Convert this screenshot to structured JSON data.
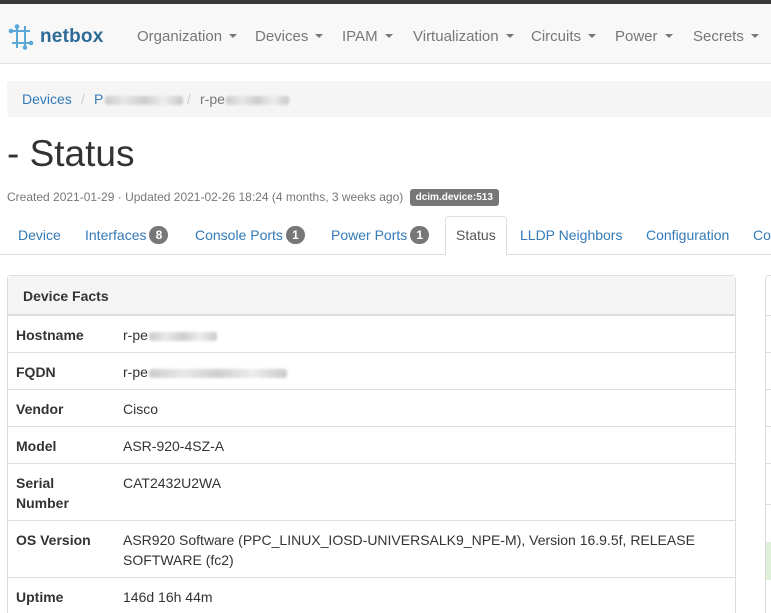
{
  "brand": {
    "name": "netbox"
  },
  "nav": {
    "items": [
      "Organization",
      "Devices",
      "IPAM",
      "Virtualization",
      "Circuits",
      "Power",
      "Secrets"
    ]
  },
  "breadcrumb": {
    "root": "Devices",
    "site_redacted": "P",
    "device_prefix": "r-pe"
  },
  "page": {
    "title": "- Status",
    "created": "Created 2021-01-29 · Updated 2021-02-26 18:24 (4 months, 3 weeks ago)",
    "badge": "dcim.device:513"
  },
  "tabs": [
    {
      "label": "Device",
      "count": null
    },
    {
      "label": "Interfaces",
      "count": "8"
    },
    {
      "label": "Console Ports",
      "count": "1"
    },
    {
      "label": "Power Ports",
      "count": "1"
    },
    {
      "label": "Status",
      "count": null,
      "active": true
    },
    {
      "label": "LLDP Neighbors",
      "count": null
    },
    {
      "label": "Configuration",
      "count": null
    },
    {
      "label": "Co",
      "count": null
    }
  ],
  "device_facts": {
    "heading": "Device Facts",
    "rows": [
      {
        "key": "Hostname",
        "value": "r-pe"
      },
      {
        "key": "FQDN",
        "value": "r-pe"
      },
      {
        "key": "Vendor",
        "value": "Cisco"
      },
      {
        "key": "Model",
        "value": "ASR-920-4SZ-A"
      },
      {
        "key": "Serial Number",
        "value": "CAT2432U2WA"
      },
      {
        "key": "OS Version",
        "value": "ASR920 Software (PPC_LINUX_IOSD-UNIVERSALK9_NPE-M), Version 16.9.5f, RELEASE SOFTWARE (fc2)"
      },
      {
        "key": "Uptime",
        "value": "146d 16h 44m"
      }
    ]
  },
  "colors": {
    "link": "#337ab7",
    "brand": "#2d6b96",
    "badge": "#777777",
    "panel_bg": "#f5f5f5",
    "success_bg": "#dff0d8"
  }
}
